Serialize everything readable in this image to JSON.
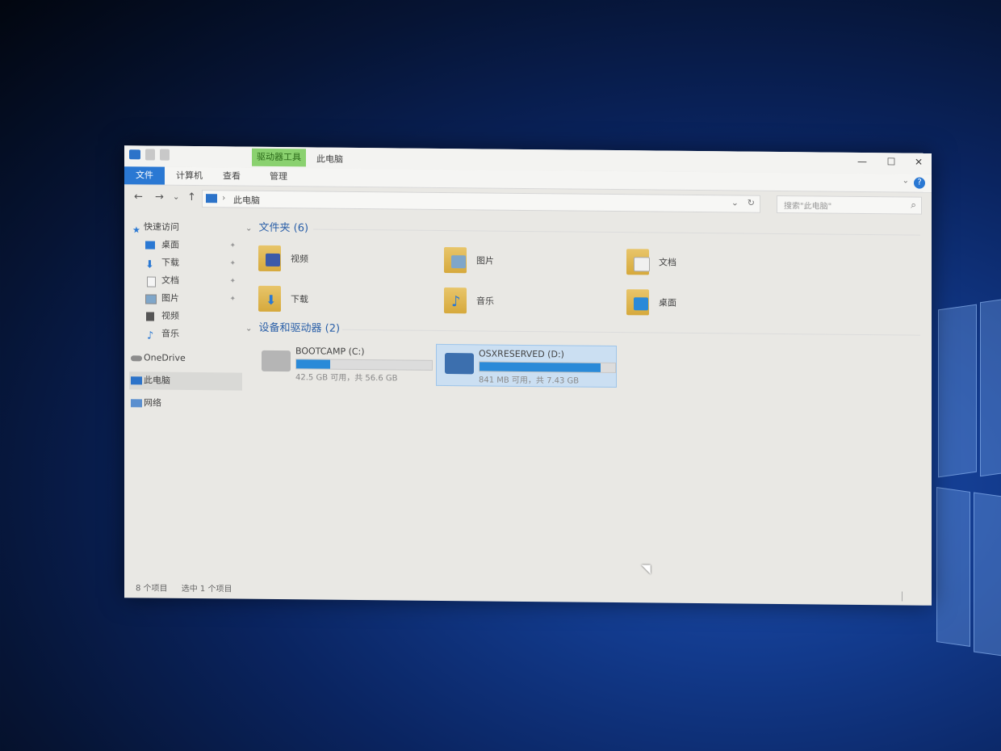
{
  "window": {
    "title": "此电脑",
    "contextual_tab": "驱动器工具",
    "minimize_icon": "—",
    "maximize_icon": "☐",
    "close_icon": "✕"
  },
  "ribbon": {
    "tabs": [
      "文件",
      "计算机",
      "查看",
      "管理"
    ],
    "help_icon": "?",
    "collapse_icon": "⌄"
  },
  "nav": {
    "back": "←",
    "forward": "→",
    "recent": "⌄",
    "up": "↑"
  },
  "address": {
    "separator": "›",
    "path": "此电脑",
    "dropdown": "⌄",
    "refresh": "↻"
  },
  "search": {
    "placeholder": "搜索\"此电脑\"",
    "icon": "⌕"
  },
  "sidebar": {
    "quick_access": "快速访问",
    "items": [
      {
        "label": "桌面",
        "pinned": true
      },
      {
        "label": "下载",
        "pinned": true
      },
      {
        "label": "文档",
        "pinned": true
      },
      {
        "label": "图片",
        "pinned": true
      },
      {
        "label": "视频",
        "pinned": false
      },
      {
        "label": "音乐",
        "pinned": false
      }
    ],
    "onedrive": "OneDrive",
    "this_pc": "此电脑",
    "network": "网络",
    "pin_icon": "📌"
  },
  "content": {
    "folders_header": "文件夹 (6)",
    "folders": [
      {
        "label": "视频",
        "icon": "video-icon",
        "color": "#3b5aa8"
      },
      {
        "label": "图片",
        "icon": "pictures-icon",
        "color": "#7fa6c9"
      },
      {
        "label": "文档",
        "icon": "documents-icon",
        "color": "#f0f0f0"
      },
      {
        "label": "下载",
        "icon": "download-icon",
        "color": "#2a78d3"
      },
      {
        "label": "音乐",
        "icon": "music-icon",
        "color": "#2a78d3"
      },
      {
        "label": "桌面",
        "icon": "desktop-icon",
        "color": "#2a8ad8"
      }
    ],
    "drives_header": "设备和驱动器 (2)",
    "drives": [
      {
        "name": "BOOTCAMP (C:)",
        "info": "42.5 GB 可用，共 56.6 GB",
        "used_fraction": 0.25,
        "selected": false
      },
      {
        "name": "OSXRESERVED (D:)",
        "info": "841 MB 可用，共 7.43 GB",
        "used_fraction": 0.89,
        "selected": true
      }
    ]
  },
  "status": {
    "items": "8 个项目",
    "selected": "选中 1 个项目"
  }
}
